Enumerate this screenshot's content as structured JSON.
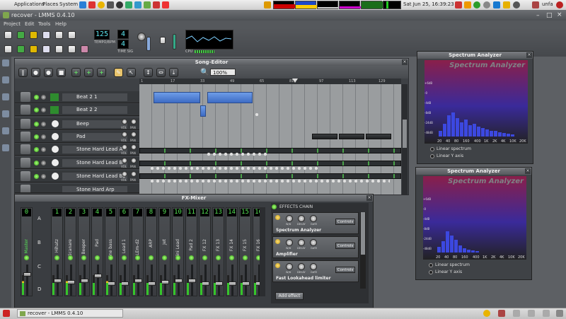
{
  "system_panel": {
    "menus": [
      "Applications",
      "Places",
      "System"
    ],
    "clock": "Sat Jun 25, 16:39:23",
    "user": "unfa"
  },
  "window": {
    "title": "recover - LMMS 0.4.10",
    "menu": [
      "Project",
      "Edit",
      "Tools",
      "Help"
    ]
  },
  "toolbar": {
    "tempo": "125",
    "tempo_label": "TEMPO/BPM",
    "timesig_num": "4",
    "timesig_den": "4",
    "timesig_label": "TIME SIG",
    "cpu_label": "CPU"
  },
  "song_editor": {
    "title": "Song-Editor",
    "zoom": "100%",
    "timeline": [
      "1",
      "17",
      "33",
      "49",
      "65",
      "81",
      "97",
      "113",
      "129"
    ],
    "tracks": [
      {
        "name": "Beat 2 1",
        "type": "beat"
      },
      {
        "name": "Beat 2 2",
        "type": "beat"
      },
      {
        "name": "Beep",
        "type": "instrument"
      },
      {
        "name": "Pad",
        "type": "instrument"
      },
      {
        "name": "Stone Hard Lead A",
        "type": "instrument"
      },
      {
        "name": "Stone Hard Lead B",
        "type": "instrument"
      },
      {
        "name": "Stone Hard Lead B2",
        "type": "instrument"
      },
      {
        "name": "Stone Hard Arp",
        "type": "instrument"
      }
    ],
    "vol_label": "VOL",
    "pan_label": "PAN"
  },
  "fx_mixer": {
    "title": "FX-Mixer",
    "groups": [
      "A",
      "B",
      "C",
      "D"
    ],
    "channels": [
      {
        "num": "0",
        "name": "Master"
      },
      {
        "num": "1",
        "name": "Hihatz"
      },
      {
        "num": "2",
        "name": "Kicanare"
      },
      {
        "num": "3",
        "name": "Beeper"
      },
      {
        "num": "4",
        "name": "Pad"
      },
      {
        "num": "5",
        "name": "Sine bass"
      },
      {
        "num": "6",
        "name": "Lead 1"
      },
      {
        "num": "7",
        "name": "LEm-d2"
      },
      {
        "num": "8",
        "name": "ARP"
      },
      {
        "num": "9",
        "name": "Jet"
      },
      {
        "num": "10",
        "name": "Wini Lead"
      },
      {
        "num": "11",
        "name": "Pad 2"
      },
      {
        "num": "12",
        "name": "FX 12"
      },
      {
        "num": "13",
        "name": "FX 13"
      },
      {
        "num": "14",
        "name": "FX 14"
      },
      {
        "num": "15",
        "name": "FX 15"
      },
      {
        "num": "16",
        "name": "FX 16"
      }
    ],
    "effects_chain_label": "EFFECTS CHAIN",
    "effects": [
      {
        "name": "Spectrum Analyzer",
        "controls": "Controls"
      },
      {
        "name": "Amplifier",
        "controls": "Controls"
      },
      {
        "name": "Fast Lookahead limiter",
        "controls": "Controls"
      }
    ],
    "knob_labels": [
      "W/D",
      "DECAY",
      "GATE"
    ],
    "add_effect": "Add effect"
  },
  "spectrum": {
    "window_title": "Spectrum Analyzer",
    "heading": "Spectrum Analyzer",
    "y_ticks": [
      "+6dB",
      "-0",
      "-4dB",
      "-8dB",
      "-24dB",
      "-48dB"
    ],
    "x_ticks": [
      "20",
      "40",
      "80",
      "160",
      "400",
      "1K",
      "2K",
      "4K",
      "10K",
      "20K"
    ],
    "opt_linear_spectrum": "Linear spectrum",
    "opt_linear_y": "Linear Y axis"
  },
  "taskbar": {
    "task": "recover - LMMS 0.4.10"
  }
}
